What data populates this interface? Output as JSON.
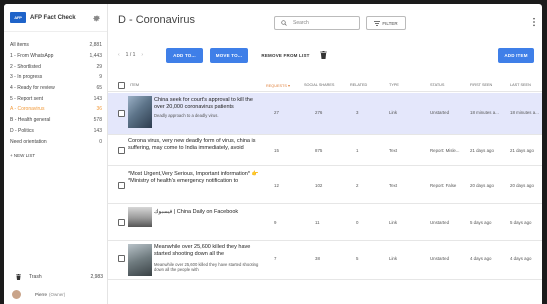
{
  "app": {
    "name": "AFP Fact Check",
    "logo_text": "AFP"
  },
  "sidebar": {
    "items": [
      {
        "label": "All items",
        "count": "2,881",
        "active": false
      },
      {
        "label": "1 - From WhatsApp",
        "count": "1,443",
        "active": false
      },
      {
        "label": "2 - Shortlisted",
        "count": "29",
        "active": false
      },
      {
        "label": "3 - In progress",
        "count": "9",
        "active": false
      },
      {
        "label": "4 - Ready for review",
        "count": "65",
        "active": false
      },
      {
        "label": "5 - Report sent",
        "count": "143",
        "active": false
      },
      {
        "label": "A - Coronavirus",
        "count": "36",
        "active": true
      },
      {
        "label": "B - Health general",
        "count": "578",
        "active": false
      },
      {
        "label": "D - Politics",
        "count": "143",
        "active": false
      },
      {
        "label": "Need orientation",
        "count": "0",
        "active": false
      }
    ],
    "new_list": "+ NEW LIST",
    "trash": {
      "label": "Trash",
      "count": "2,983"
    },
    "user": {
      "name": "Pierre",
      "role": "(Owner)"
    }
  },
  "header": {
    "title": "D - Coronavirus",
    "search_placeholder": "Search",
    "filter_label": "FILTER"
  },
  "toolbar": {
    "pager": "1 / 1",
    "prev": "‹",
    "next": "›",
    "add_to": "ADD TO...",
    "move_to": "MOVE TO...",
    "remove": "REMOVE FROM LIST",
    "add_item": "ADD ITEM"
  },
  "table": {
    "columns": {
      "item": "ITEM",
      "requests": "REQUESTS ▾",
      "social": "SOCIAL SHARES",
      "related": "RELATED",
      "type": "TYPE",
      "status": "STATUS",
      "first_seen": "FIRST SEEN",
      "last_seen": "LAST SEEN"
    },
    "rows": [
      {
        "title": "China seek for court's approval to kill the over 20,000 coronavirus patients",
        "subtitle": "Deadly approach to a deadly virus.",
        "requests": "27",
        "social": "276",
        "related": "3",
        "type": "Link",
        "status": "Unstarted",
        "first": "18 minutes a...",
        "last": "18 minutes a..."
      },
      {
        "title": "Corona virus, very new deadly form of virus, china is suffering, may come to India immediately, avoid",
        "subtitle": "",
        "requests": "15",
        "social": "875",
        "related": "1",
        "type": "Text",
        "status": "Report: Misle...",
        "first": "21 days ago",
        "last": "21 days ago"
      },
      {
        "title": "*Most Urgent,Very Serious, Important information* 👉 *Ministry of health's emergency notification to",
        "subtitle": "",
        "requests": "12",
        "social": "102",
        "related": "2",
        "type": "Text",
        "status": "Report: False",
        "first": "20 days ago",
        "last": "20 days ago"
      },
      {
        "title": "فيسبوك | China Daily on Facebook",
        "subtitle": "",
        "requests": "9",
        "social": "11",
        "related": "0",
        "type": "Link",
        "status": "Unstarted",
        "first": "5 days ago",
        "last": "5 days ago"
      },
      {
        "title": "Meanwhile over 25,600 killed they have started shooting down all the",
        "subtitle": "Meanwhile over 25,600 killed they have started shooting down all the people with",
        "requests": "7",
        "social": "38",
        "related": "5",
        "type": "Link",
        "status": "Unstarted",
        "first": "4 days ago",
        "last": "4 days ago"
      }
    ]
  }
}
